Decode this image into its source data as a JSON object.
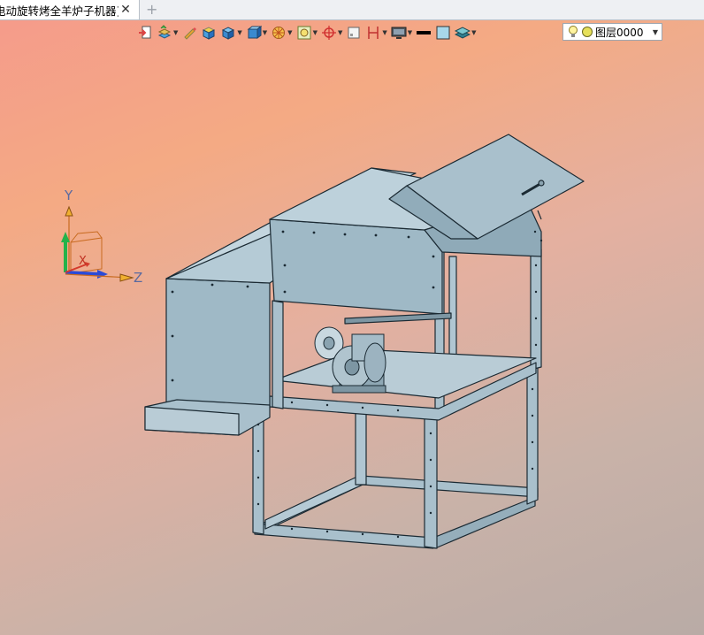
{
  "tab": {
    "title": "电动旋转烤全羊炉子机器]",
    "close_glyph": "✕",
    "add_glyph": "+"
  },
  "toolbar": {
    "items": [
      {
        "icon": "import-icon"
      },
      {
        "icon": "layers-view-icon"
      },
      {
        "icon": "pencil-icon"
      },
      {
        "icon": "shaded-box-icon"
      },
      {
        "icon": "solid-box-icon"
      },
      {
        "icon": "view-cube-icon"
      },
      {
        "icon": "sun-render-icon"
      },
      {
        "icon": "zoom-fit-icon"
      },
      {
        "icon": "target-snap-icon"
      },
      {
        "icon": "blank-page-icon"
      },
      {
        "icon": "dimension-icon"
      },
      {
        "icon": "display-mode-icon"
      },
      {
        "icon": "line-color-icon"
      },
      {
        "icon": "fill-color-icon"
      },
      {
        "icon": "layer-stack-icon"
      }
    ],
    "layer": {
      "value": "图层0000"
    }
  },
  "triad": {
    "y_label": "Y",
    "x_label": "X",
    "z_label": "Z"
  },
  "colors": {
    "model_fill": "#9fb9c6",
    "model_stroke": "#1b2a33",
    "x_axis": "#d33a2c",
    "y_axis": "#23b34a",
    "z_axis": "#2a4ad8"
  }
}
